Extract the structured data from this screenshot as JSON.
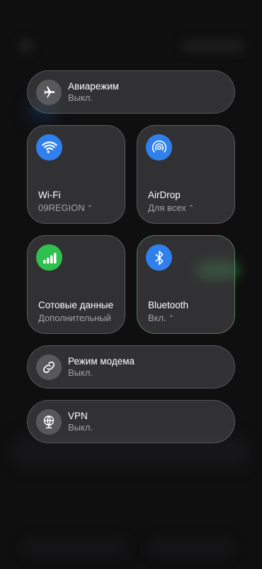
{
  "airplane": {
    "title": "Авиарежим",
    "status": "Выкл."
  },
  "wifi": {
    "title": "Wi-Fi",
    "status": "09REGION",
    "chevron": "⌃"
  },
  "airdrop": {
    "title": "AirDrop",
    "status": "Для всех",
    "chevron": "⌃"
  },
  "cellular": {
    "title": "Сотовые данные",
    "status": "Дополнительный"
  },
  "bluetooth": {
    "title": "Bluetooth",
    "status": "Вкл.",
    "chevron": "⌃"
  },
  "hotspot": {
    "title": "Режим модема",
    "status": "Выкл."
  },
  "vpn": {
    "title": "VPN",
    "status": "Выкл."
  },
  "colors": {
    "accent_blue": "#2f80ed",
    "accent_green": "#30c04f"
  }
}
